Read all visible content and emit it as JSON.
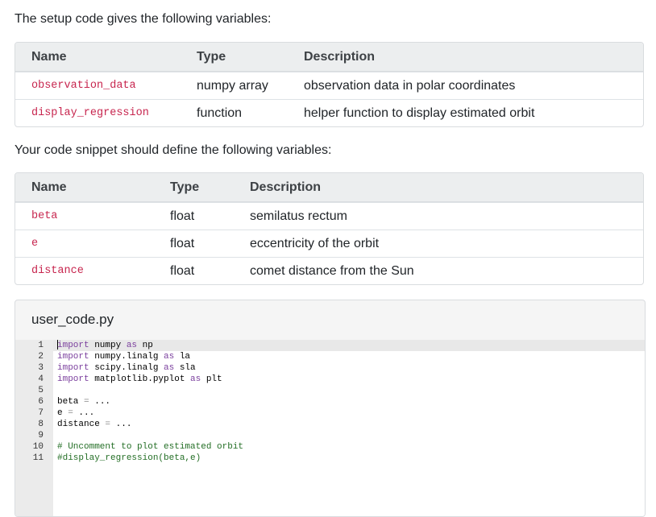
{
  "intro_setup": "The setup code gives the following variables:",
  "intro_define": "Your code snippet should define the following variables:",
  "setup_table": {
    "headers": {
      "name": "Name",
      "type": "Type",
      "description": "Description"
    },
    "rows": [
      {
        "name": "observation_data",
        "type": "numpy array",
        "description": "observation data in polar coordinates"
      },
      {
        "name": "display_regression",
        "type": "function",
        "description": "helper function to display estimated orbit"
      }
    ]
  },
  "define_table": {
    "headers": {
      "name": "Name",
      "type": "Type",
      "description": "Description"
    },
    "rows": [
      {
        "name": "beta",
        "type": "float",
        "description": "semilatus rectum"
      },
      {
        "name": "e",
        "type": "float",
        "description": "eccentricity of the orbit"
      },
      {
        "name": "distance",
        "type": "float",
        "description": "comet distance from the Sun"
      }
    ]
  },
  "editor": {
    "filename": "user_code.py",
    "line_numbers": [
      "1",
      "2",
      "3",
      "4",
      "5",
      "6",
      "7",
      "8",
      "9",
      "10",
      "11"
    ],
    "lines": {
      "l1": {
        "kw1": "import",
        "mod": " numpy ",
        "kw2": "as",
        "alias": " np"
      },
      "l2": {
        "kw1": "import",
        "mod": " numpy.linalg ",
        "kw2": "as",
        "alias": " la"
      },
      "l3": {
        "kw1": "import",
        "mod": " scipy.linalg ",
        "kw2": "as",
        "alias": " sla"
      },
      "l4": {
        "kw1": "import",
        "mod": " matplotlib.pyplot ",
        "kw2": "as",
        "alias": " plt"
      },
      "l6": {
        "var": "beta ",
        "eq": "=",
        "val": " ..."
      },
      "l7": {
        "var": "e ",
        "eq": "=",
        "val": " ..."
      },
      "l8": {
        "var": "distance ",
        "eq": "=",
        "val": " ..."
      },
      "l10": "# Uncomment to plot estimated orbit",
      "l11": "#display_regression(beta,e)"
    }
  },
  "colors": {
    "name_text": "#c7254e",
    "keyword": "#7a3e9d",
    "comment": "#236e25",
    "header_bg": "#eceeef"
  }
}
